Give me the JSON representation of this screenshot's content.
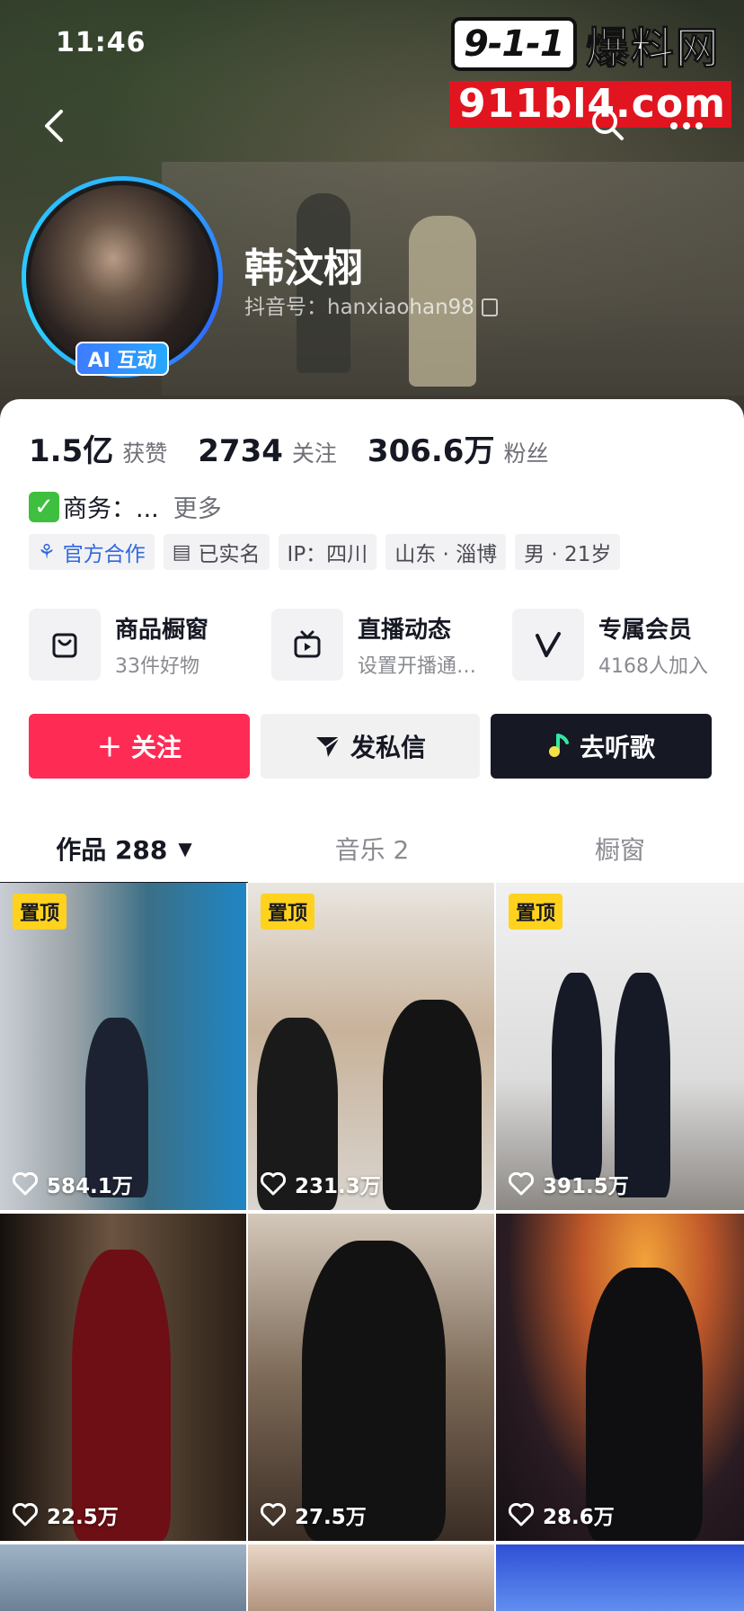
{
  "status_bar": {
    "time": "11:46"
  },
  "watermark": {
    "logo_number": "9-1-1",
    "logo_text": "爆料网",
    "url": "911bl4.com"
  },
  "profile": {
    "name": "韩汶栩",
    "douyin_id": "抖音号：hanxiaohan98",
    "ai_badge": "AI 互动"
  },
  "stats": [
    {
      "value": "1.5亿",
      "label": "获赞"
    },
    {
      "value": "2734",
      "label": "关注"
    },
    {
      "value": "306.6万",
      "label": "粉丝"
    }
  ],
  "bio": {
    "text": "商务：...",
    "more": "更多"
  },
  "tags": [
    {
      "label": "官方合作",
      "icon": "handshake-icon"
    },
    {
      "label": "已实名",
      "icon": "id-card-icon"
    },
    {
      "label": "IP：四川"
    },
    {
      "label": "山东 · 淄博"
    },
    {
      "label": "男 · 21岁"
    }
  ],
  "services": [
    {
      "title": "商品橱窗",
      "subtitle": "33件好物",
      "icon": "shopping-bag-icon"
    },
    {
      "title": "直播动态",
      "subtitle": "设置开播通…",
      "icon": "tv-icon"
    },
    {
      "title": "专属会员",
      "subtitle": "4168人加入",
      "icon": "v-member-icon"
    }
  ],
  "actions": {
    "follow": "关注",
    "message": "发私信",
    "music": "去听歌"
  },
  "tabs": [
    {
      "label": "作品 288"
    },
    {
      "label": "音乐 2"
    },
    {
      "label": "橱窗"
    }
  ],
  "videos": [
    {
      "pinned": "置顶",
      "likes": "584.1万"
    },
    {
      "pinned": "置顶",
      "likes": "231.3万"
    },
    {
      "pinned": "置顶",
      "likes": "391.5万"
    },
    {
      "likes": "22.5万"
    },
    {
      "likes": "27.5万"
    },
    {
      "likes": "28.6万"
    }
  ],
  "colors": {
    "follow_red": "#fe2c55",
    "pin_yellow": "#ffd21e",
    "dark": "#161823",
    "ai_blue": "#3e7bff"
  }
}
